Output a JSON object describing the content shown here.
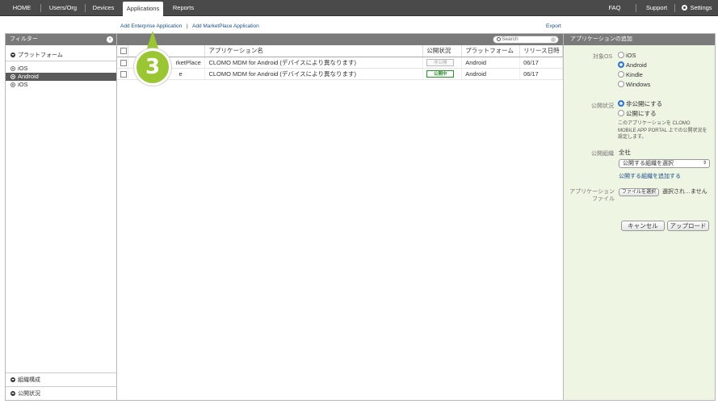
{
  "nav": {
    "home": "HOME",
    "users_org": "Users/Org",
    "devices": "Devices",
    "applications": "Applications",
    "reports": "Reports",
    "faq": "FAQ",
    "support": "Support",
    "settings": "Settings"
  },
  "sublinks": {
    "add_enterprise": "Add Enterprise Application",
    "separator": "|",
    "add_marketplace": "Add MarketPlace Application",
    "export": "Export"
  },
  "filter": {
    "title": "フィルター",
    "platform_label": "プラットフォーム",
    "items": [
      "iOS",
      "Android",
      "iOS"
    ],
    "bottom": [
      "組織構成",
      "公開状況"
    ]
  },
  "search": {
    "placeholder": "Search"
  },
  "table": {
    "headers": [
      "",
      "",
      "アプリケーション名",
      "公開状況",
      "プラットフォーム",
      "リリース日時"
    ],
    "rows": [
      {
        "source": "rketPlace",
        "name": "CLOMO MDM for Android (デバイスにより異なります)",
        "status": "非公開",
        "status_type": "private",
        "platform": "Android",
        "date": "06/17"
      },
      {
        "source": "e",
        "name": "CLOMO MDM for Android (デバイスにより異なります)",
        "status": "公開中",
        "status_type": "public",
        "platform": "Android",
        "date": "06/17"
      }
    ]
  },
  "step_marker": "3",
  "right_panel": {
    "title": "アプリケーションの追加",
    "os_label": "対象OS",
    "os_options": [
      "iOS",
      "Android",
      "Kindle",
      "Windows"
    ],
    "os_selected": "Android",
    "status_label": "公開状況",
    "status_options": [
      "非公開にする",
      "公開にする"
    ],
    "status_selected": "非公開にする",
    "status_note": "このアプリケーションを CLOMO MOBILE APP PORTAL 上での公開状況を設定します。",
    "org_label": "公開組織",
    "org_value": "全社",
    "org_select": "公開する組織を選択",
    "org_add_link": "公開する組織を追加する",
    "file_label_1": "アプリケーション",
    "file_label_2": "ファイル",
    "file_button": "ファイルを選択",
    "file_status": "選択され…ません",
    "cancel_button": "キャンセル",
    "upload_button": "アップロード"
  },
  "colors": {
    "accent_green": "#9bc634",
    "public_green": "#2f8f2f",
    "link_blue": "#1a4f8a",
    "topbar": "#4a4a4a"
  }
}
